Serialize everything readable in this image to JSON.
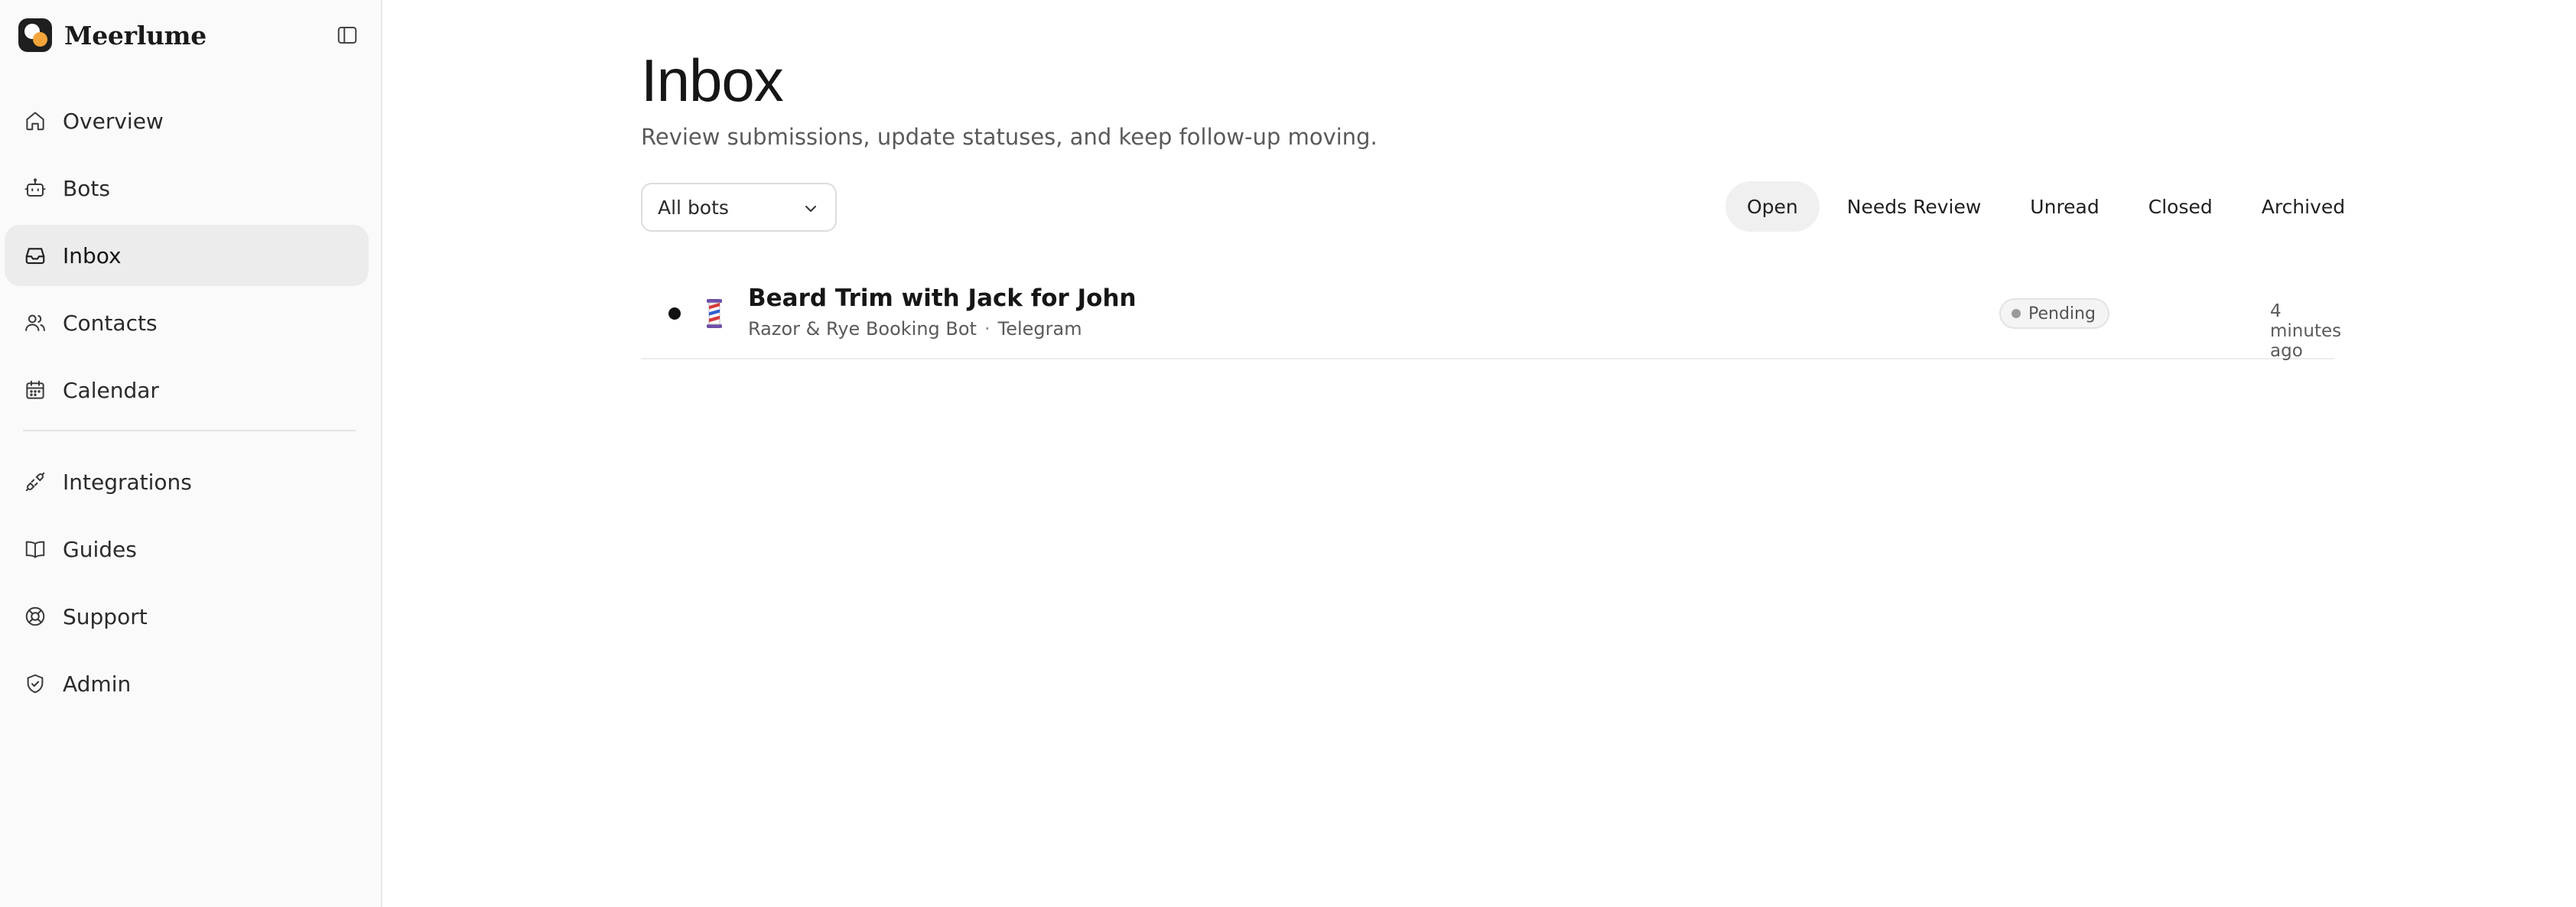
{
  "brand": {
    "name": "Meerlume"
  },
  "sidebar": {
    "items": [
      {
        "label": "Overview",
        "icon": "home-icon"
      },
      {
        "label": "Bots",
        "icon": "bot-icon"
      },
      {
        "label": "Inbox",
        "icon": "inbox-icon",
        "active": true
      },
      {
        "label": "Contacts",
        "icon": "users-icon"
      },
      {
        "label": "Calendar",
        "icon": "calendar-icon"
      }
    ],
    "secondary_items": [
      {
        "label": "Integrations",
        "icon": "plug-icon"
      },
      {
        "label": "Guides",
        "icon": "book-icon"
      },
      {
        "label": "Support",
        "icon": "lifebuoy-icon"
      },
      {
        "label": "Admin",
        "icon": "shield-icon"
      }
    ]
  },
  "main": {
    "title": "Inbox",
    "subtitle": "Review submissions, update statuses, and keep follow-up moving.",
    "bot_filter": {
      "selected": "All bots"
    },
    "tabs": [
      {
        "label": "Open",
        "active": true
      },
      {
        "label": "Needs Review"
      },
      {
        "label": "Unread"
      },
      {
        "label": "Closed"
      },
      {
        "label": "Archived"
      }
    ],
    "rows": [
      {
        "title": "Beard Trim with Jack for John",
        "bot": "Razor & Rye Booking Bot",
        "separator": "·",
        "channel": "Telegram",
        "status": "Pending",
        "time": "4 minutes ago",
        "unread": true,
        "icon": "barber-pole-icon"
      }
    ]
  },
  "colors": {
    "sidebar_bg": "#fafafa",
    "active_item_bg": "#ececec",
    "accent_logo": "#f3a53a",
    "badge_bg": "#f4f4f4"
  }
}
